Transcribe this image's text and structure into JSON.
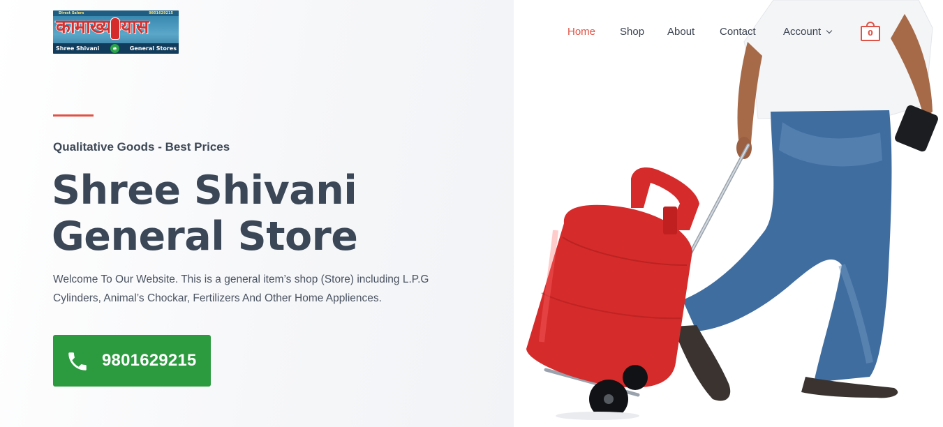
{
  "logo": {
    "top_left": "Direct Salers",
    "top_right": "9801629215",
    "script": "कामाख्य ग्यास",
    "bottom_left": "Shree Shivani",
    "bottom_badge": "e",
    "bottom_right": "General Stores"
  },
  "nav": {
    "items": [
      {
        "label": "Home",
        "active": true
      },
      {
        "label": "Shop"
      },
      {
        "label": "About"
      },
      {
        "label": "Contact"
      },
      {
        "label": "Account",
        "has_dropdown": true
      }
    ],
    "cart_count": "0"
  },
  "hero": {
    "tagline": "Qualitative Goods - Best Prices",
    "title_line1": "Shree Shivani",
    "title_line2": "General Store",
    "description": "Welcome To Our Website. This is a general item’s shop (Store) including L.P.G Cylinders, Animal’s Chockar, Fertilizers And Other Home Appliences.",
    "call_number": "9801629215",
    "call_icon": "phone-icon",
    "image_subject": "person pulling red LPG cylinder on trolley"
  },
  "colors": {
    "accent": "#e05245",
    "button": "#2c9a3e",
    "heading": "#3b4757",
    "cylinder": "#d62b2b"
  }
}
